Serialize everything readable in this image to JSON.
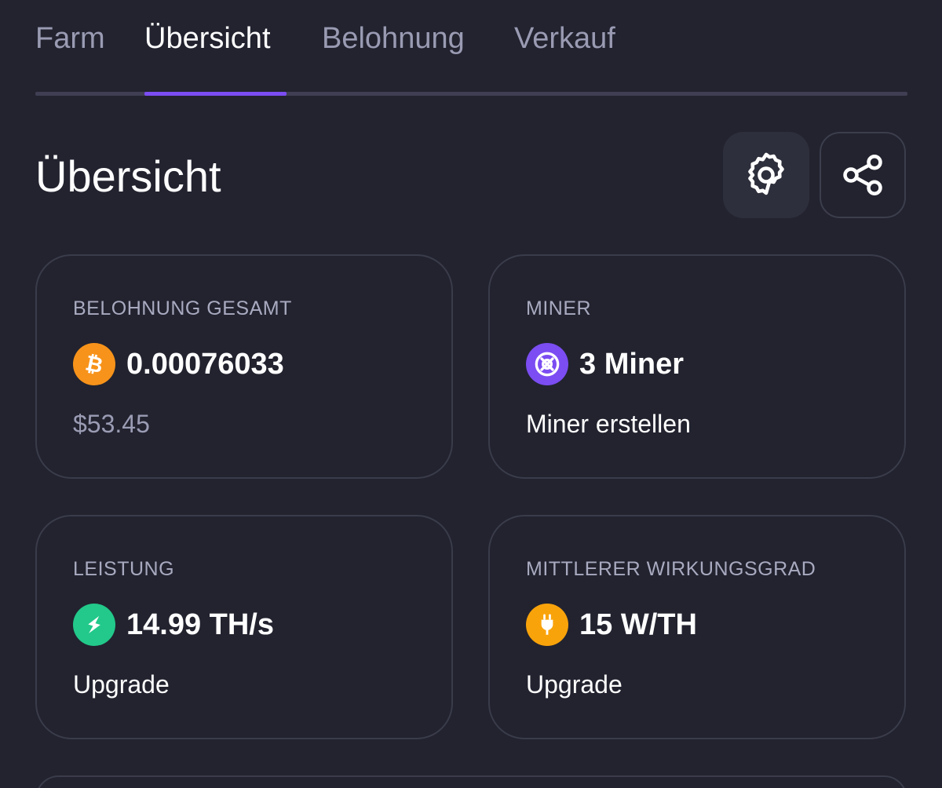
{
  "tabs": [
    {
      "label": "Farm",
      "active": false
    },
    {
      "label": "Übersicht",
      "active": true
    },
    {
      "label": "Belohnung",
      "active": false
    },
    {
      "label": "Verkauf",
      "active": false
    }
  ],
  "header": {
    "title": "Übersicht",
    "settings_icon": "gear-icon",
    "share_icon": "share-icon"
  },
  "cards": {
    "reward": {
      "label": "BELOHNUNG GESAMT",
      "icon": "bitcoin-icon",
      "value": "0.00076033",
      "sub": "$53.45"
    },
    "miner": {
      "label": "MINER",
      "icon": "miner-icon",
      "value": "3 Miner",
      "sub": "Miner erstellen"
    },
    "power": {
      "label": "LEISTUNG",
      "icon": "lightning-icon",
      "value": "14.99 TH/s",
      "sub": "Upgrade"
    },
    "efficiency": {
      "label": "MITTLERER WIRKUNGSGRAD",
      "icon": "plug-icon",
      "value": "15 W/TH",
      "sub": "Upgrade"
    }
  },
  "colors": {
    "background": "#22232f",
    "accent": "#7b4df2",
    "bitcoin": "#f7931a",
    "miner": "#7b4df2",
    "power": "#22c98a",
    "efficiency": "#f9a30b"
  }
}
